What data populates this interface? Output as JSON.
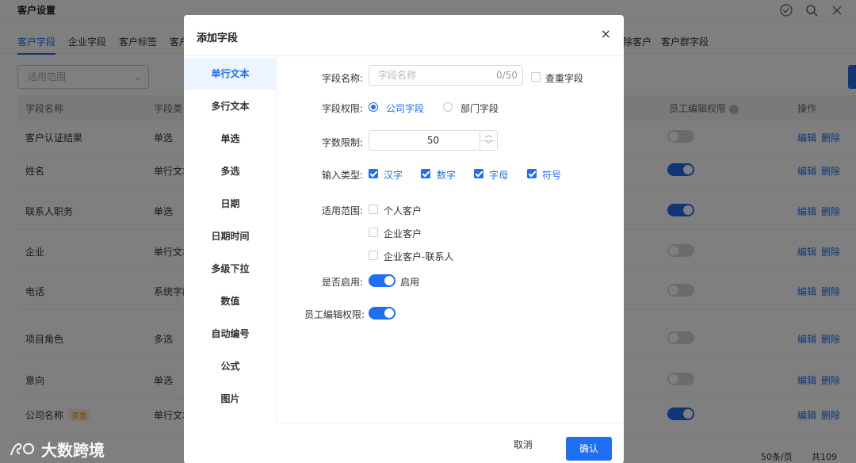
{
  "page": {
    "title": "客户设置"
  },
  "tabs": [
    "客户字段",
    "企业字段",
    "客户标签",
    "客户",
    "除客户",
    "客户群字段"
  ],
  "filter": {
    "placeholder": "适用范围"
  },
  "table": {
    "headers": [
      "字段名称",
      "字段类",
      "员工编辑权限",
      "操作"
    ],
    "rows": [
      {
        "name": "客户认证结果",
        "type": "单选",
        "tag": "",
        "enabled": false,
        "actions": [
          "编辑",
          "删除"
        ],
        "edit_disabled": false,
        "delete_disabled": false
      },
      {
        "name": "姓名",
        "type": "单行文本",
        "tag": "",
        "enabled": true,
        "actions": [
          "编辑",
          "删除"
        ],
        "edit_disabled": false,
        "delete_disabled": true
      },
      {
        "name": "联系人职务",
        "type": "单选",
        "tag": "",
        "enabled": true,
        "actions": [
          "编辑",
          "删除"
        ],
        "edit_disabled": false,
        "delete_disabled": false
      },
      {
        "name": "企业",
        "type": "单行文本",
        "tag": "",
        "enabled": false,
        "actions": [
          "编辑",
          "删除"
        ],
        "edit_disabled": false,
        "delete_disabled": true
      },
      {
        "name": "电话",
        "type": "系统字段",
        "tag": "",
        "enabled": false,
        "actions": [
          "编辑",
          "删除"
        ],
        "edit_disabled": false,
        "delete_disabled": true
      },
      {
        "name": "项目角色",
        "type": "多选",
        "tag": "",
        "enabled": false,
        "actions": [
          "编辑",
          "删除"
        ],
        "edit_disabled": false,
        "delete_disabled": false
      },
      {
        "name": "意向",
        "type": "单选",
        "tag": "",
        "enabled": false,
        "actions": [
          "编辑",
          "删除"
        ],
        "edit_disabled": false,
        "delete_disabled": true
      },
      {
        "name": "公司名称",
        "type": "单行文本",
        "tag": "查重",
        "enabled": true,
        "actions": [
          "编辑",
          "删除"
        ],
        "edit_disabled": false,
        "delete_disabled": false
      }
    ]
  },
  "pager": {
    "size": "50条/页",
    "total": "共109"
  },
  "brand": {
    "name": "大数跨境"
  },
  "modal": {
    "title": "添加字段",
    "close": "×",
    "field_types": [
      "单行文本",
      "多行文本",
      "单选",
      "多选",
      "日期",
      "日期时间",
      "多级下拉",
      "数值",
      "自动编号",
      "公式",
      "图片"
    ],
    "active_type": 0,
    "form": {
      "name_label": "字段名称:",
      "name_placeholder": "字段名称",
      "name_counter": "0/50",
      "dedupe_label": "查重字段",
      "perm_label": "字段权限:",
      "perm_options": [
        "公司字段",
        "部门字段"
      ],
      "perm_selected": 0,
      "limit_label": "字数限制:",
      "limit_value": "50",
      "input_type_label": "输入类型:",
      "input_types": [
        "汉字",
        "数字",
        "字母",
        "符号"
      ],
      "scope_label": "适用范围:",
      "scopes": [
        "个人客户",
        "企业客户",
        "企业客户-联系人"
      ],
      "enable_label": "是否启用:",
      "enable_text": "启用",
      "staff_edit_label": "员工编辑权限:"
    },
    "cancel": "取消",
    "confirm": "确认"
  },
  "colors": {
    "accent": "#1e6ff1"
  }
}
